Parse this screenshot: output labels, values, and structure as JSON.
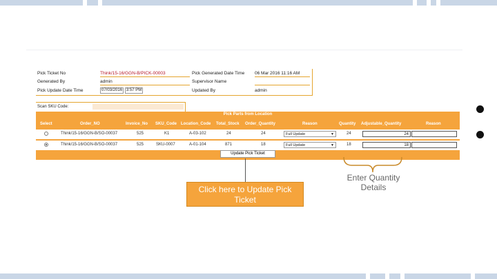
{
  "ticket_info": {
    "pick_ticket_no_label": "Pick Ticket No",
    "pick_ticket_no_value": "Think/15-16/GGN-B/PICK-00003",
    "generated_by_label": "Generated By",
    "generated_by_value": "admin",
    "pick_update_date_label": "Pick Update Date Time",
    "pick_update_date_value": "07/03/2016",
    "pick_update_time_value": "3:57 PM",
    "pick_generated_date_label": "Pick Generated Date Time",
    "pick_generated_date_value": "06 Mar 2016 11:16 AM",
    "supervisor_label": "Supervisor Name",
    "supervisor_value": "",
    "updated_by_label": "Updated By",
    "updated_by_value": "admin"
  },
  "scan": {
    "label": "Scan SKU Code:",
    "value": ""
  },
  "grid": {
    "title": "Pick Parts from Location",
    "headers": {
      "select": "Select",
      "order_no": "Order_NO",
      "invoice_no": "Invoice_No",
      "sku_code": "SKU_Code",
      "location_code": "Location_Code",
      "total_stock": "Total_Stock",
      "order_quantity": "Order_Quantity",
      "reason": "Reason",
      "quantity": "Quantity",
      "adjustable_quantity": "Adjustable_Quantity",
      "reason2": "Reason"
    },
    "rows": [
      {
        "selected": false,
        "order_no": "Think/15-16/GGN-B/SO-00037",
        "invoice_no": "525",
        "sku_code": "K1",
        "location_code": "A-03-102",
        "total_stock": "24",
        "order_quantity": "24",
        "reason": "Full Update",
        "quantity": "24",
        "adjustable_quantity": "24"
      },
      {
        "selected": true,
        "order_no": "Think/15-16/GGN-B/SO-00037",
        "invoice_no": "525",
        "sku_code": "SKU-0007",
        "location_code": "A-01-104",
        "total_stock": "871",
        "order_quantity": "18",
        "reason": "Full Update",
        "quantity": "18",
        "adjustable_quantity": "18"
      }
    ],
    "update_button": "Update Pick Ticket"
  },
  "annotations": {
    "update_callout": "Click here to Update Pick Ticket",
    "quantity_callout": "Enter Quantity Details"
  },
  "colors": {
    "accent": "#f5a43c",
    "stripe": "#c9d6e6",
    "ticket_red": "#b5192b"
  }
}
